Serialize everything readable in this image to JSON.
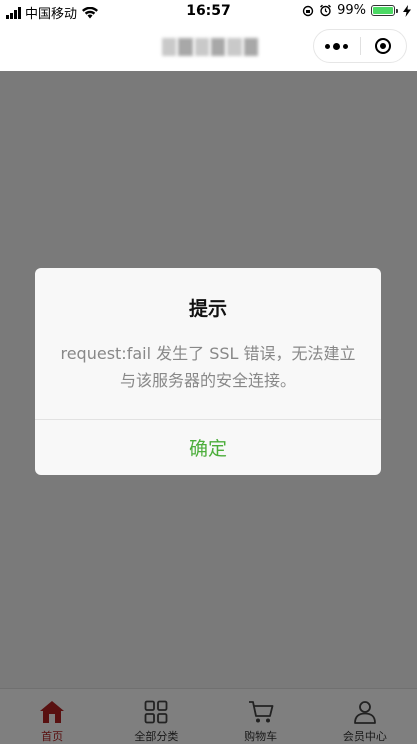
{
  "status_bar": {
    "carrier": "中国移动",
    "time": "16:57",
    "battery": "99%",
    "battery_level": 0.99
  },
  "nav_bar": {
    "more_icon": "more-dots-icon",
    "close_icon": "target-circle-icon"
  },
  "dialog": {
    "title": "提示",
    "message": "request:fail 发生了 SSL 错误，无法建立与该服务器的安全连接。",
    "confirm_label": "确定"
  },
  "tab_bar": {
    "items": [
      {
        "label": "首页",
        "icon": "home-icon",
        "active": true
      },
      {
        "label": "全部分类",
        "icon": "grid-icon",
        "active": false
      },
      {
        "label": "购物车",
        "icon": "cart-icon",
        "active": false
      },
      {
        "label": "会员中心",
        "icon": "user-icon",
        "active": false
      }
    ]
  },
  "colors": {
    "active_tab": "#b22222",
    "confirm_text": "#4cae3b",
    "battery_fill": "#4cd964"
  }
}
